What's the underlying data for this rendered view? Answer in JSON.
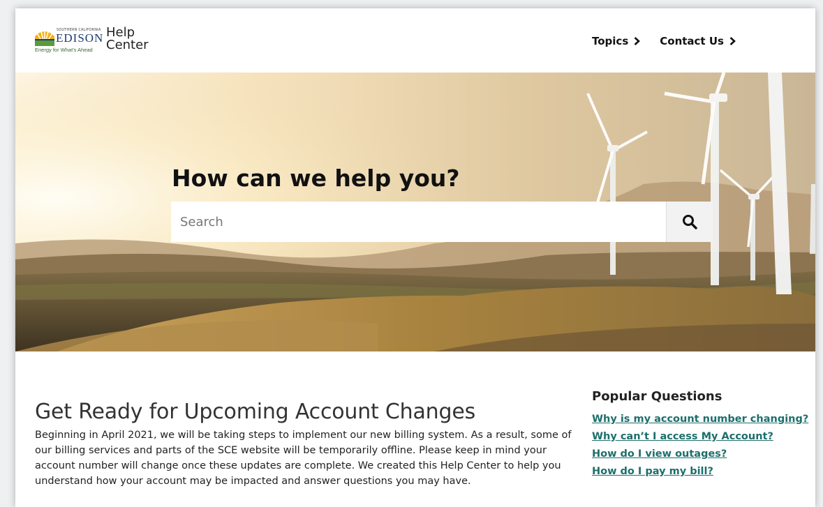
{
  "brand": {
    "logo_small_text": "SOUTHERN CALIFORNIA",
    "logo_name": "EDISON",
    "logo_tagline": "Energy for What's Ahead",
    "site_title_line1": "Help",
    "site_title_line2": "Center",
    "colors": {
      "sun_yellow": "#f6b21b",
      "sun_green": "#5a9b3a",
      "navy": "#1b3b70"
    }
  },
  "nav": {
    "items": [
      {
        "label": "Topics"
      },
      {
        "label": "Contact Us"
      }
    ]
  },
  "hero": {
    "title": "How can we help you?",
    "search": {
      "placeholder": "Search",
      "value": ""
    },
    "search_icon": "search-icon"
  },
  "article": {
    "heading": "Get Ready for Upcoming Account Changes",
    "body": "Beginning in April 2021, we will be taking steps to implement our new billing system. As a result, some of our billing services and parts of the SCE website will be temporarily offline. Please keep in mind your account number will change once these updates are complete. We created this Help Center to help you understand how your account may be impacted and answer questions you may have."
  },
  "popular": {
    "title": "Popular Questions",
    "link_color": "#1c6f6b",
    "questions": [
      {
        "label": "Why is my account number changing?"
      },
      {
        "label": "Why can’t I access My Account?"
      },
      {
        "label": "How do I view outages?"
      },
      {
        "label": "How do I pay my bill?"
      }
    ]
  }
}
